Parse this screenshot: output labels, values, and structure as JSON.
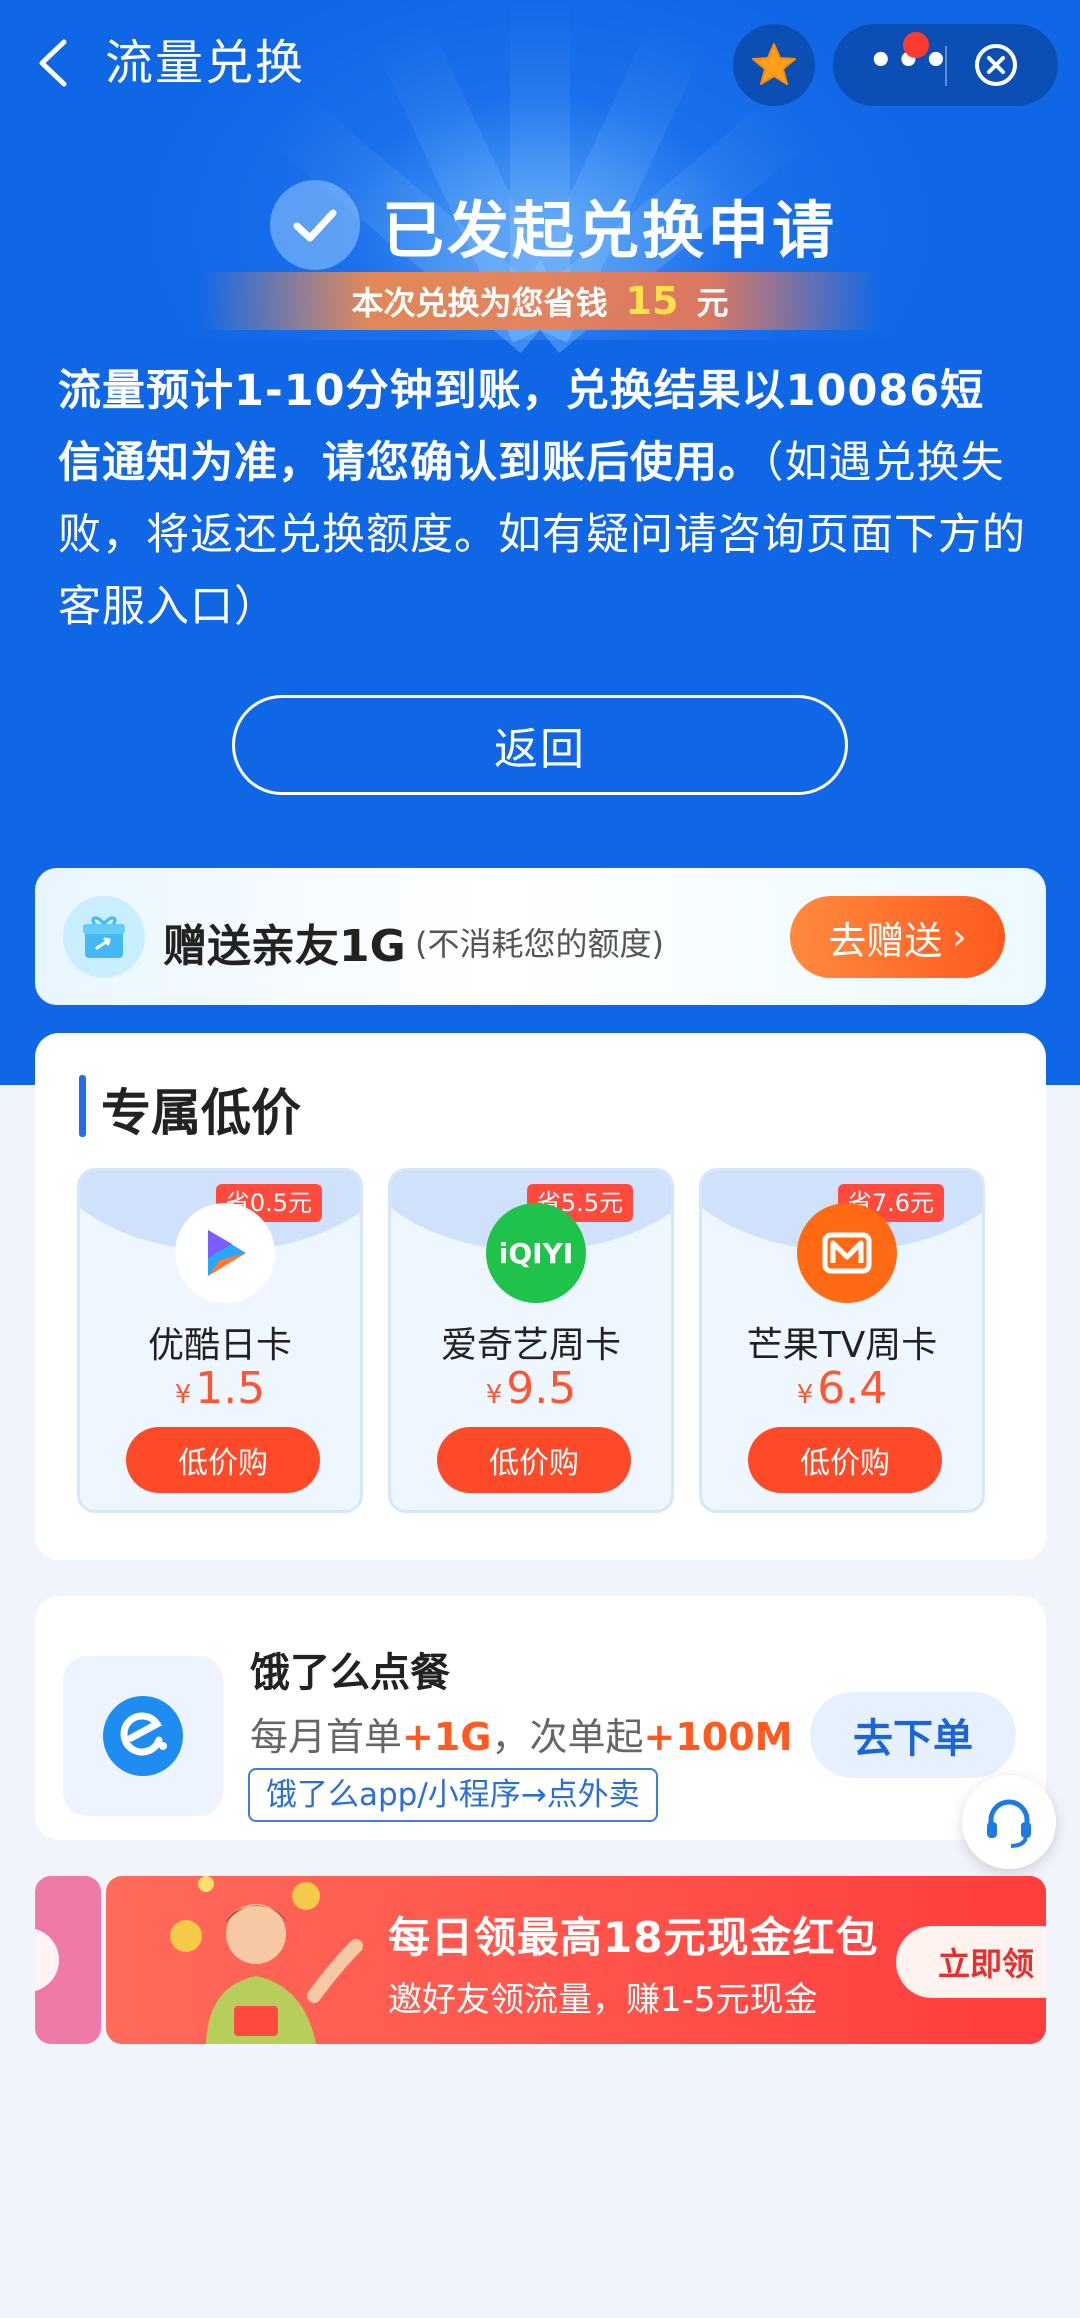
{
  "header": {
    "title": "流量兑换"
  },
  "status": {
    "title": "已发起兑换申请",
    "save_prefix": "本次兑换为您省钱",
    "save_amount": "15",
    "save_unit": "元"
  },
  "notice": {
    "bold_text": "流量预计1-10分钟到账，兑换结果以10086短信通知为准，请您确认到账后使用。",
    "light_text": "（如遇兑换失败，将返还兑换额度。如有疑问请咨询页面下方的客服入口）"
  },
  "return_label": "返回",
  "gift": {
    "title": "赠送亲友1G",
    "subtitle": "(不消耗您的额度)",
    "button": "去赠送"
  },
  "exclusive": {
    "title": "专属低价",
    "products": [
      {
        "name": "优酷日卡",
        "price": "1.5",
        "currency": "¥",
        "badge": "省0.5元",
        "button": "低价购",
        "logo": "youku-logo"
      },
      {
        "name": "爱奇艺周卡",
        "price": "9.5",
        "currency": "¥",
        "badge": "省5.5元",
        "button": "低价购",
        "logo_text": "iQIYI"
      },
      {
        "name": "芒果TV周卡",
        "price": "6.4",
        "currency": "¥",
        "badge": "省7.6元",
        "button": "低价购",
        "logo": "mango-tv-logo"
      }
    ]
  },
  "eleme": {
    "title": "饿了么点餐",
    "desc_1": "每月首单",
    "desc_hl_1": "+1G",
    "desc_2": "，次单起",
    "desc_hl_2": "+100M",
    "tag": "饿了么app/小程序→点外卖",
    "button": "去下单"
  },
  "banner": {
    "title": "每日领最高18元现金红包",
    "subtitle": "邀好友领流量，赚1-5元现金",
    "cta": "立即领"
  },
  "colors": {
    "primary_blue": "#0f67e6",
    "orange": "#ff5a1f",
    "red": "#ff4a2a"
  }
}
